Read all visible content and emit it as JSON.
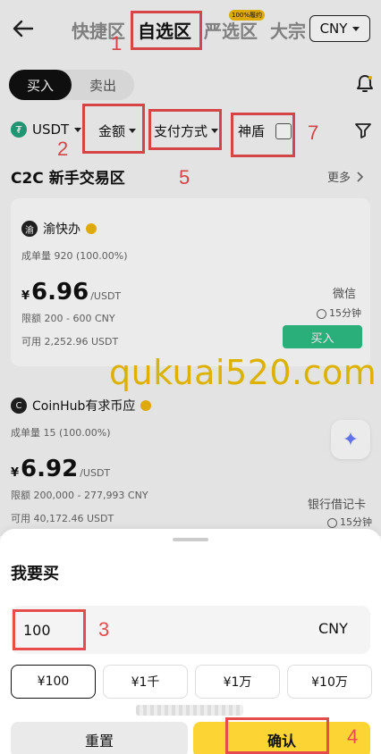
{
  "header": {
    "tabs": [
      "快捷区",
      "自选区",
      "严选区",
      "大宗"
    ],
    "active_tab": "自选区",
    "badge": "100%履约",
    "currency": "CNY"
  },
  "trade": {
    "buy": "买入",
    "sell": "卖出"
  },
  "filters": {
    "coin": "USDT",
    "amount": "金额",
    "payment": "支付方式",
    "shield": "神盾"
  },
  "annotations": [
    "1",
    "2",
    "3",
    "4",
    "5",
    "7"
  ],
  "section": {
    "title": "C2C 新手交易区",
    "more": "更多"
  },
  "card1": {
    "avatar": "渝",
    "name": "渝快办",
    "orders": "成单量 920 (100.00%)",
    "currency_symbol": "¥",
    "price": "6.96",
    "unit": "/USDT",
    "limit": "限额  200 - 600 CNY",
    "available": "可用  2,252.96 USDT",
    "pay_method": "微信",
    "time": "15分钟",
    "buy": "买入"
  },
  "watermark": "qukuai520.com",
  "card2": {
    "avatar": "C",
    "name": "CoinHub有求币应",
    "orders": "成单量 15 (100.00%)",
    "currency_symbol": "¥",
    "price": "6.92",
    "unit": "/USDT",
    "limit": "限额  200,000 - 277,993 CNY",
    "available": "可用  40,172.46 USDT",
    "pay_method": "银行借记卡",
    "time": "15分钟"
  },
  "sheet": {
    "title": "我要买",
    "amount_value": "100",
    "amount_unit": "CNY",
    "chips": [
      "¥100",
      "¥1千",
      "¥1万",
      "¥10万"
    ],
    "reset": "重置",
    "confirm": "确认"
  }
}
